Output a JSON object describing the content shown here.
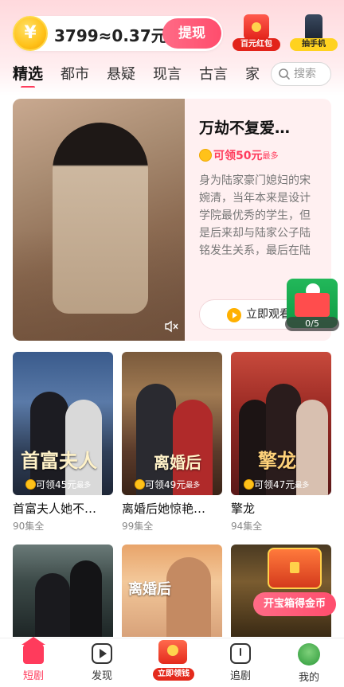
{
  "header": {
    "coin_symbol": "¥",
    "coin_balance": "3799≈0.37元",
    "withdraw_label": "提现",
    "promo_redpacket_label": "百元红包",
    "promo_phone_label": "抽手机"
  },
  "tabs": [
    "精选",
    "都市",
    "悬疑",
    "现言",
    "古言",
    "家"
  ],
  "active_tab": "精选",
  "search": {
    "placeholder": "搜索"
  },
  "featured": {
    "title": "万劫不复爱…",
    "reward": "可领50元",
    "reward_suffix": "最多",
    "description": "身为陆家豪门媳妇的宋婉清，当年本来是设计学院最优秀的学生，但是后来却与陆家公子陆铭发生关系，最后在陆家老…",
    "watch_label": "立即观看"
  },
  "float_widget": {
    "count": "0/5"
  },
  "grid": [
    {
      "title": "首富夫人她不…",
      "episodes": "90集全",
      "reward": "可领45元",
      "reward_suffix": "最多",
      "calligraphy": "首富夫人"
    },
    {
      "title": "离婚后她惊艳…",
      "episodes": "99集全",
      "reward": "可领49元",
      "reward_suffix": "最多",
      "calligraphy": "离婚后"
    },
    {
      "title": "擎龙",
      "episodes": "94集全",
      "reward": "可领47元",
      "reward_suffix": "最多",
      "calligraphy": "擎龙"
    },
    {
      "title": "",
      "episodes": "",
      "reward": "",
      "reward_suffix": "",
      "calligraphy": ""
    },
    {
      "title": "",
      "episodes": "",
      "reward": "",
      "reward_suffix": "",
      "calligraphy": "离婚后"
    },
    {
      "title": "",
      "episodes": "",
      "reward": "",
      "reward_suffix": "",
      "calligraphy": ""
    }
  ],
  "treasure": {
    "label": "开宝箱得金币"
  },
  "bottom_nav": {
    "home": "短剧",
    "discover": "发现",
    "center": "立即领钱",
    "follow": "追剧",
    "mine": "我的"
  },
  "colors": {
    "accent": "#ff3b5c",
    "gold": "#ffc21a"
  }
}
